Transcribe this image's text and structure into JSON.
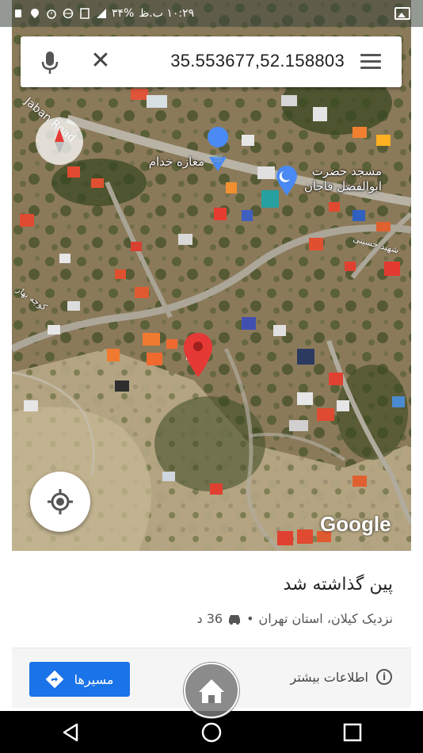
{
  "status_bar": {
    "time": "۱۰:۲۹ ب.ظ",
    "battery": "۳۴%",
    "icons": [
      "signal-icon",
      "wifi-icon",
      "battery-icon",
      "sim-icon",
      "globe-icon",
      "alarm-icon",
      "location-icon",
      "notification-icon",
      "gallery-icon"
    ]
  },
  "search": {
    "coordinates": "35.553677,52.158803",
    "mic_icon": "mic-icon",
    "close_icon": "close-icon",
    "menu_icon": "menu-icon"
  },
  "map": {
    "road_label": "Jaban Road",
    "place_labels": [
      {
        "name": "مغازه خدام",
        "icon": "shopping-cart-pin-icon"
      },
      {
        "name": "مسجد حضرت\nابوالفضل فاجان",
        "icon": "mosque-pin-icon"
      }
    ],
    "street_labels": [
      "شهید حسینی",
      "کوچه بهار"
    ],
    "pin_icon": "red-location-pin-icon",
    "logo": "Google",
    "compass_icon": "compass-icon",
    "my_location_icon": "my-location-icon"
  },
  "info_panel": {
    "title": "پین گذاشته شد",
    "subtitle_place": "نزدیک کیلان، استان تهران",
    "separator": "•",
    "drive_time": "36 د",
    "directions_label": "مسیرها",
    "more_info_label": "اطلاعات بیشتر"
  },
  "nav_bar": {
    "buttons": [
      "back-icon",
      "home-icon",
      "recent-apps-icon"
    ]
  },
  "colors": {
    "accent": "#1a73e8",
    "pin": "#e53935"
  }
}
